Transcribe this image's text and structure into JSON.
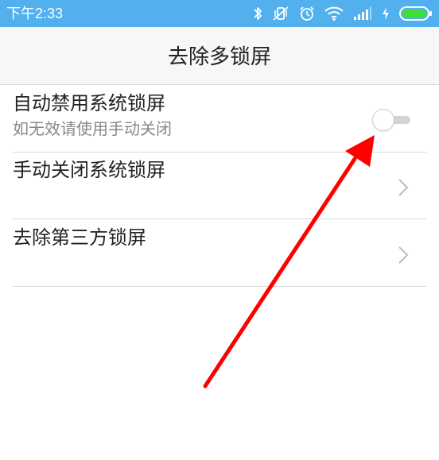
{
  "status_bar": {
    "time": "下午2:33",
    "bg_color": "#52b0ee",
    "icons": [
      "bluetooth-icon",
      "vibrate-off-icon",
      "alarm-icon",
      "wifi-icon",
      "signal-icon",
      "charging-icon",
      "battery-icon"
    ]
  },
  "header": {
    "title": "去除多锁屏"
  },
  "settings": [
    {
      "title": "自动禁用系统锁屏",
      "subtitle": "如无效请使用手动关闭",
      "control": "toggle",
      "toggle_on": false
    },
    {
      "title": "手动关闭系统锁屏",
      "control": "chevron"
    },
    {
      "title": "去除第三方锁屏",
      "control": "chevron"
    }
  ],
  "annotation": {
    "arrow_color": "#ff0000",
    "points_to": "toggle"
  }
}
